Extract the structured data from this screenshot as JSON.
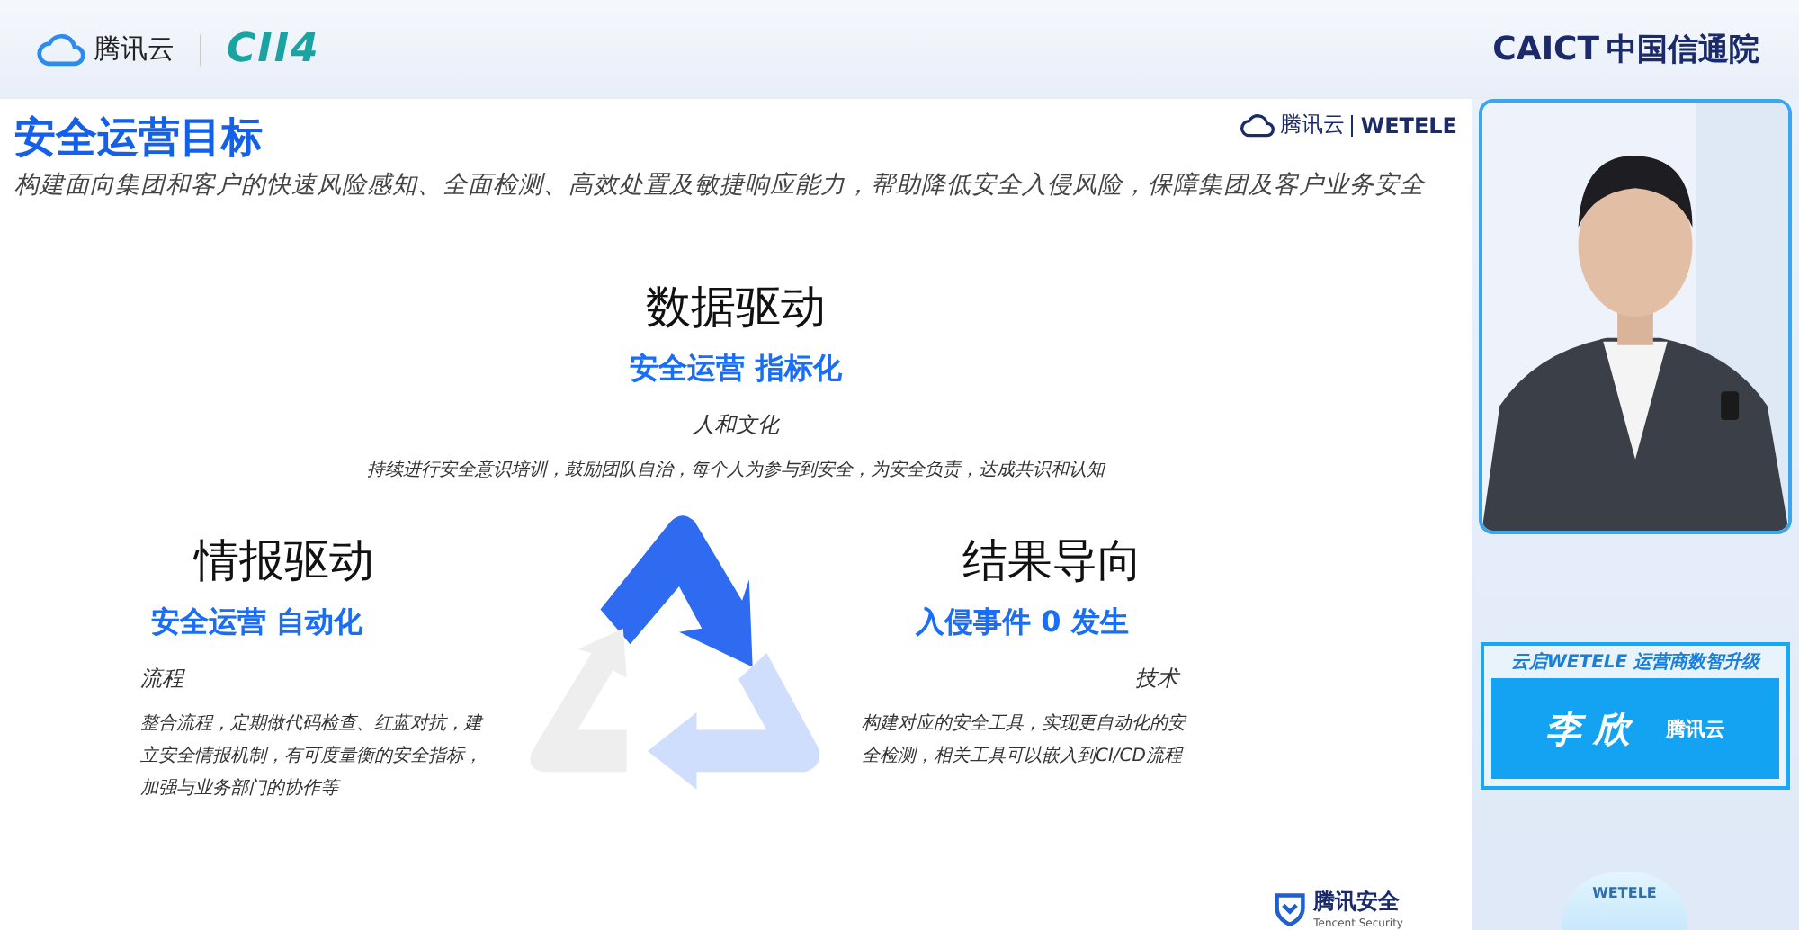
{
  "header": {
    "brand": "腾讯云",
    "event_logo": "CII4",
    "org_logo": "CAICT",
    "org_name": "中国信通院"
  },
  "slide": {
    "title": "安全运营目标",
    "subtitle": "构建面向集团和客户的快速风险感知、全面检测、高效处置及敏捷响应能力，帮助降低安全入侵风险，保障集团及客户业务安全",
    "brands": [
      "腾讯云",
      "WETELE"
    ],
    "sections": [
      {
        "heading": "数据驱动",
        "tagline": "安全运营 指标化",
        "label": "人和文化",
        "description": "持续进行安全意识培训，鼓励团队自治，每个人为参与到安全，为安全负责，达成共识和认知"
      },
      {
        "heading": "情报驱动",
        "tagline": "安全运营 自动化",
        "label": "流程",
        "description": "整合流程，定期做代码检查、红蓝对抗，建立安全情报机制，有可度量衡的安全指标，加强与业务部门的协作等"
      },
      {
        "heading": "结果导向",
        "tagline": "入侵事件 0 发生",
        "label": "技术",
        "description": "构建对应的安全工具，实现更自动化的安全检测，相关工具可以嵌入到CI/CD流程"
      }
    ],
    "footer": {
      "name": "腾讯安全",
      "subname": "Tencent Security"
    }
  },
  "speaker": {
    "banner": "云启WETELE 运营商数智升级",
    "name": "李 欣",
    "org": "腾讯云",
    "cloud_label": "WETELE"
  }
}
